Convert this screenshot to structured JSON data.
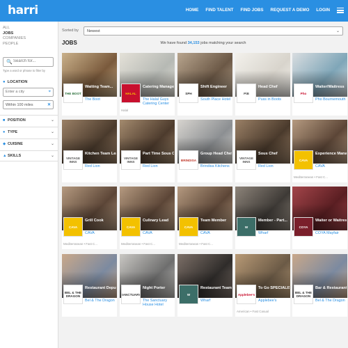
{
  "header": {
    "logo": "harri",
    "nav": [
      "HOME",
      "FIND TALENT",
      "FIND JOBS",
      "REQUEST A DEMO",
      "LOGIN"
    ]
  },
  "sidebar": {
    "types": [
      "ALL",
      "JOBS",
      "COMPANIES",
      "PEOPLE"
    ],
    "search_placeholder": "Search for...",
    "search_help": "Type a word or phrase to filter by",
    "location_label": "LOCATION",
    "city_placeholder": "Enter a city",
    "radius": "Within 100 miles",
    "filters": [
      "POSITION",
      "TYPE",
      "CUISINE",
      "SKILLS"
    ]
  },
  "sort": {
    "label": "Sorted by",
    "value": "Newest"
  },
  "jobs_title": "JOBS",
  "count": {
    "prefix": "We have found",
    "number": "34,153",
    "suffix": "jobs matching your search"
  },
  "cards": [
    {
      "title": "Waiting Team...",
      "company": "The Boot",
      "logo": "THE BOOT",
      "meta": "",
      "photo": "#7a5a3c",
      "photo2": "#c9b08a",
      "logo_bg": "#fff",
      "logo_fg": "#2a6f3a"
    },
    {
      "title": "Catering Manager",
      "company": "The Halal Guys Catering Center",
      "logo": "HALAL",
      "meta": "Halal",
      "photo": "#b6b9b4",
      "photo2": "#e4e1d8",
      "logo_bg": "#c8102e",
      "logo_fg": "#f5c400"
    },
    {
      "title": "Shift Engineer",
      "company": "South Place Hotel",
      "logo": "SPH",
      "meta": "",
      "photo": "#6b5846",
      "photo2": "#b8a58e",
      "logo_bg": "#fff",
      "logo_fg": "#333"
    },
    {
      "title": "Head Chef",
      "company": "Puss in Boots",
      "logo": "PiB",
      "meta": "",
      "photo": "#d8d4cc",
      "photo2": "#f3f1ec",
      "logo_bg": "#fff",
      "logo_fg": "#444"
    },
    {
      "title": "Waiter/Waitress",
      "company": "Pho Bournemouth",
      "logo": "Pho",
      "meta": "",
      "photo": "#7fa6b8",
      "photo2": "#d9dde0",
      "logo_bg": "#fff",
      "logo_fg": "#c8102e"
    },
    {
      "title": "Kitchen Team Leader",
      "company": "Red Lion",
      "logo": "VINTAGE INNS",
      "meta": "",
      "photo": "#4a3a2c",
      "photo2": "#9a8066",
      "logo_bg": "#fff",
      "logo_fg": "#555"
    },
    {
      "title": "Part Time Sous Chef",
      "company": "Red Lion",
      "logo": "VINTAGE INNS",
      "meta": "",
      "photo": "#4d3b2d",
      "photo2": "#a38a6e",
      "logo_bg": "#fff",
      "logo_fg": "#555"
    },
    {
      "title": "Group Head Chef",
      "company": "Brindisa Kitchens",
      "logo": "BRINDISA",
      "meta": "",
      "photo": "#8c8f92",
      "photo2": "#d7d4cf",
      "logo_bg": "#fff",
      "logo_fg": "#c0392b"
    },
    {
      "title": "Sous Chef",
      "company": "Red Lion",
      "logo": "VINTAGE INNS",
      "meta": "",
      "photo": "#4a3a2c",
      "photo2": "#9a8066",
      "logo_bg": "#fff",
      "logo_fg": "#555"
    },
    {
      "title": "Experience Manager",
      "company": "CAVA",
      "logo": "CAVA",
      "meta": "Mediterranean • Fast C...",
      "photo": "#5c4637",
      "photo2": "#b59a80",
      "logo_bg": "#f3c100",
      "logo_fg": "#fff"
    },
    {
      "title": "Grill Cook",
      "company": "CAVA",
      "logo": "CAVA",
      "meta": "Mediterranean • Fast C...",
      "photo": "#5c4637",
      "photo2": "#b59a80",
      "logo_bg": "#f3c100",
      "logo_fg": "#fff"
    },
    {
      "title": "Culinary Lead",
      "company": "CAVA",
      "logo": "CAVA",
      "meta": "Mediterranean • Fast C...",
      "photo": "#5c4637",
      "photo2": "#b59a80",
      "logo_bg": "#f3c100",
      "logo_fg": "#fff"
    },
    {
      "title": "Team Member",
      "company": "CAVA",
      "logo": "CAVA",
      "meta": "Mediterranean • Fast C...",
      "photo": "#5c4637",
      "photo2": "#b59a80",
      "logo_bg": "#f3c100",
      "logo_fg": "#fff"
    },
    {
      "title": "Member - Part...",
      "company": "Wharf",
      "logo": "W",
      "meta": "",
      "photo": "#3e3a36",
      "photo2": "#8d847a",
      "logo_bg": "#3c6e68",
      "logo_fg": "#fff"
    },
    {
      "title": "Waiter or Waitress",
      "company": "COYA Mayfair",
      "logo": "COYA",
      "meta": "",
      "photo": "#5a1e22",
      "photo2": "#a3454a",
      "logo_bg": "#7a1f2b",
      "logo_fg": "#fff"
    },
    {
      "title": "Restaurant Deputy...",
      "company": "Bel & The Dragon",
      "logo": "BEL & THE DRAGON",
      "meta": "",
      "photo": "#7c8aa0",
      "photo2": "#c9a88a",
      "logo_bg": "#fff",
      "logo_fg": "#333"
    },
    {
      "title": "Night Porter",
      "company": "The Sanctuary House Hotel",
      "logo": "SANCTUARY",
      "meta": "",
      "photo": "#6e6e6e",
      "photo2": "#c9c7c3",
      "logo_bg": "#fff",
      "logo_fg": "#333"
    },
    {
      "title": "Restaurant Team...",
      "company": "Wharf",
      "logo": "W",
      "meta": "",
      "photo": "#2f2c2a",
      "photo2": "#7d7068",
      "logo_bg": "#3c6e68",
      "logo_fg": "#fff"
    },
    {
      "title": "To Go SPECIALIST -...",
      "company": "Applebee's",
      "logo": "Applebee's",
      "meta": "American • Fast Casual",
      "photo": "#6b5a46",
      "photo2": "#b89a76",
      "logo_bg": "#fff",
      "logo_fg": "#c8102e"
    },
    {
      "title": "Bar & Restaurant...",
      "company": "Bel & The Dragon",
      "logo": "BEL & THE DRAGON",
      "meta": "",
      "photo": "#7c8aa0",
      "photo2": "#c9a88a",
      "logo_bg": "#fff",
      "logo_fg": "#333"
    }
  ]
}
